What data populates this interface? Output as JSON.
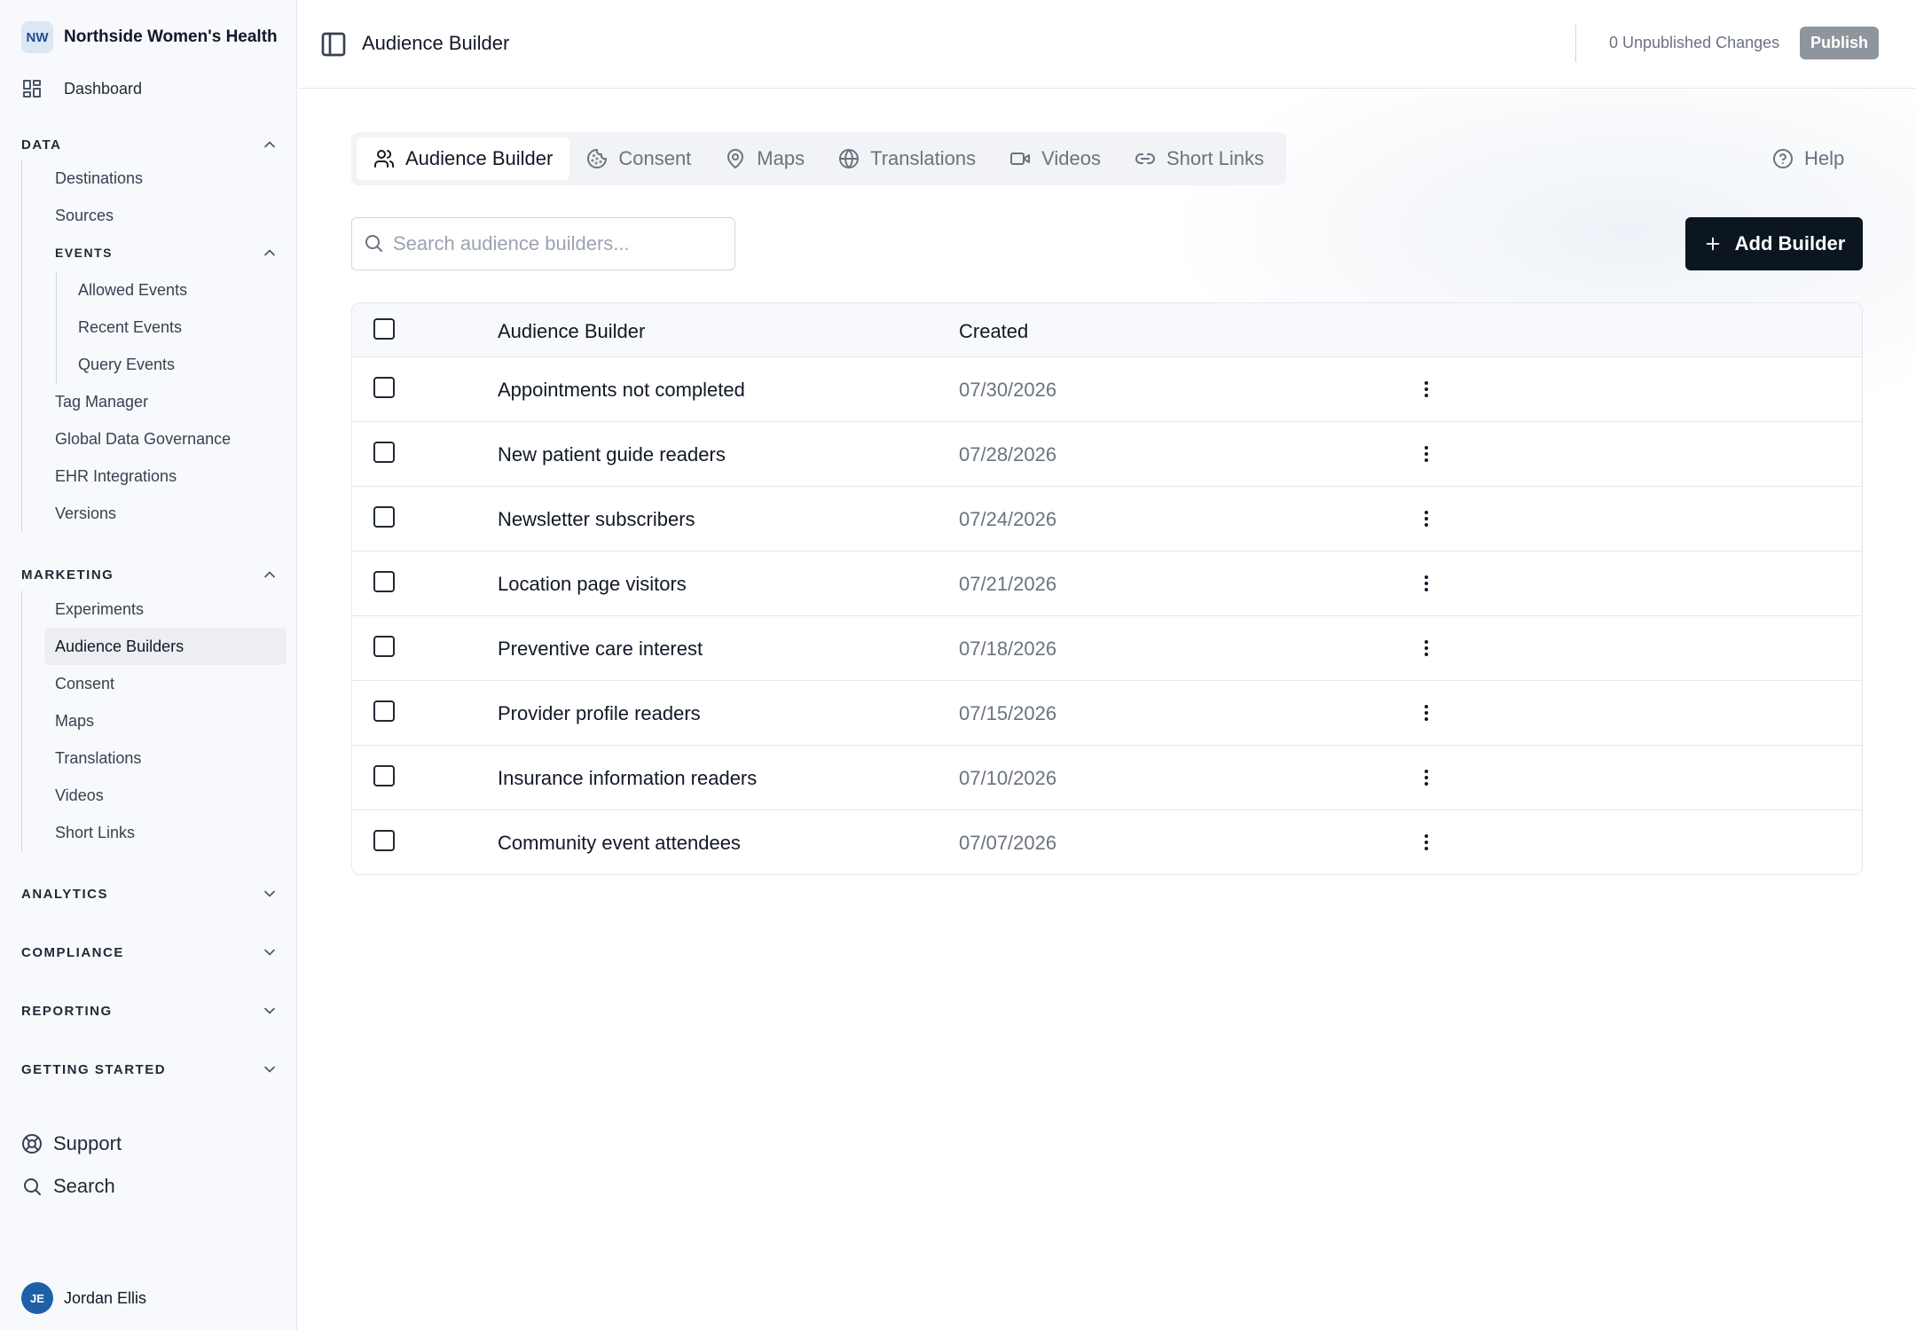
{
  "sidebar": {
    "brand": {
      "initials": "NW",
      "name": "Northside Women's Health"
    },
    "dashboard": {
      "label": "Dashboard",
      "icon": "dashboard-icon"
    },
    "data": {
      "title": "DATA",
      "items": [
        "Destinations",
        "Sources"
      ],
      "events": {
        "title": "EVENTS",
        "items": [
          "Allowed Events",
          "Recent Events",
          "Query Events"
        ]
      },
      "items_after": [
        "Tag Manager",
        "Global Data Governance",
        "EHR Integrations",
        "Versions"
      ]
    },
    "marketing": {
      "title": "MARKETING",
      "items": [
        "Experiments",
        "Audience Builders",
        "Consent",
        "Maps",
        "Translations",
        "Videos",
        "Short Links"
      ],
      "active_item": "Audience Builders"
    },
    "collapsed_sections": [
      "ANALYTICS",
      "COMPLIANCE",
      "REPORTING",
      "GETTING STARTED"
    ],
    "bottom": {
      "support": "Support",
      "search": "Search"
    },
    "user": {
      "initials": "JE",
      "name": "Jordan Ellis"
    }
  },
  "header": {
    "title": "Audience Builder",
    "unpublished": "0 Unpublished Changes",
    "publish": "Publish"
  },
  "tabs": [
    {
      "label": "Audience Builder",
      "icon": "users-icon",
      "active": true
    },
    {
      "label": "Consent",
      "icon": "cookie-icon",
      "active": false
    },
    {
      "label": "Maps",
      "icon": "map-pin-icon",
      "active": false
    },
    {
      "label": "Translations",
      "icon": "globe-icon",
      "active": false
    },
    {
      "label": "Videos",
      "icon": "video-icon",
      "active": false
    },
    {
      "label": "Short Links",
      "icon": "link-icon",
      "active": false
    }
  ],
  "help": "Help",
  "search": {
    "placeholder": "Search audience builders...",
    "value": ""
  },
  "add_button": "Add Builder",
  "table": {
    "columns": [
      "Audience Builder",
      "Created"
    ],
    "rows": [
      {
        "name": "Appointments not completed",
        "created": "07/30/2026"
      },
      {
        "name": "New patient guide readers",
        "created": "07/28/2026"
      },
      {
        "name": "Newsletter subscribers",
        "created": "07/24/2026"
      },
      {
        "name": "Location page visitors",
        "created": "07/21/2026"
      },
      {
        "name": "Preventive care interest",
        "created": "07/18/2026"
      },
      {
        "name": "Provider profile readers",
        "created": "07/15/2026"
      },
      {
        "name": "Insurance information readers",
        "created": "07/10/2026"
      },
      {
        "name": "Community event attendees",
        "created": "07/07/2026"
      }
    ]
  },
  "colors": {
    "primary_button": "#0b1620",
    "publish_button": "#8f959c",
    "sidebar_bg": "#f7f9fc",
    "avatar": "#1f5fa8"
  }
}
